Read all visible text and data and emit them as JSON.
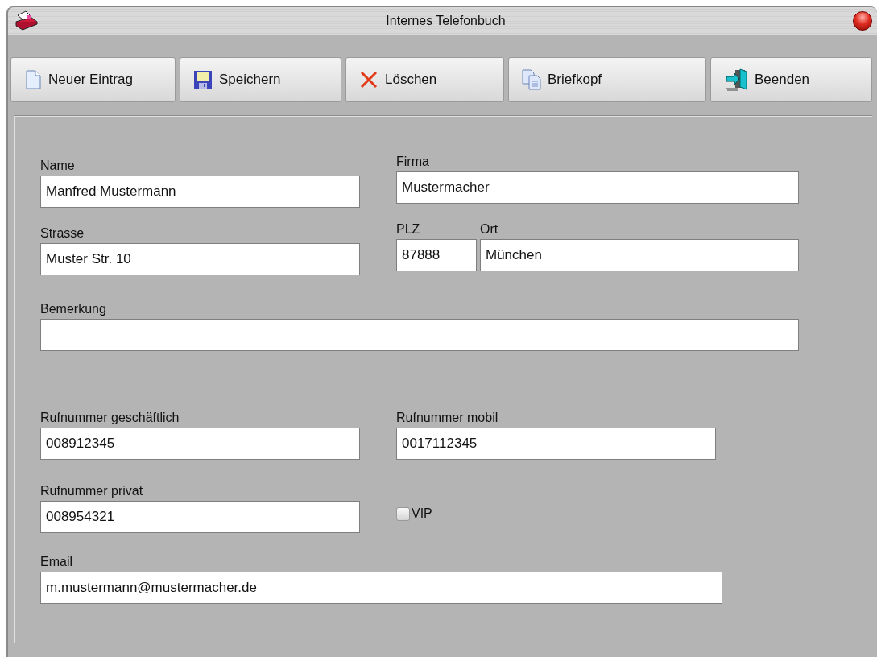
{
  "window": {
    "title": "Internes Telefonbuch"
  },
  "toolbar": [
    {
      "kind": "new",
      "label": "Neuer Eintrag"
    },
    {
      "kind": "save",
      "label": "Speichern"
    },
    {
      "kind": "delete",
      "label": "Löschen"
    },
    {
      "kind": "copy",
      "label": "Briefkopf"
    },
    {
      "kind": "exit",
      "label": "Beenden"
    }
  ],
  "form": {
    "name": {
      "label": "Name",
      "value": "Manfred Mustermann"
    },
    "firma": {
      "label": "Firma",
      "value": "Mustermacher"
    },
    "strasse": {
      "label": "Strasse",
      "value": "Muster Str. 10"
    },
    "plz": {
      "label": "PLZ",
      "value": "87888"
    },
    "ort": {
      "label": "Ort",
      "value": "München"
    },
    "bemerkung": {
      "label": "Bemerkung"
    },
    "tel_business": {
      "label": "Rufnummer geschäftlich",
      "value": "008912345"
    },
    "tel_mobile": {
      "label": "Rufnummer mobil",
      "value": "0017112345"
    },
    "tel_private": {
      "label": "Rufnummer privat",
      "value": "008954321"
    },
    "vip": {
      "label": "VIP",
      "checked": false
    },
    "email": {
      "label": "Email",
      "value": "m.mustermann@mustermacher.de"
    }
  }
}
